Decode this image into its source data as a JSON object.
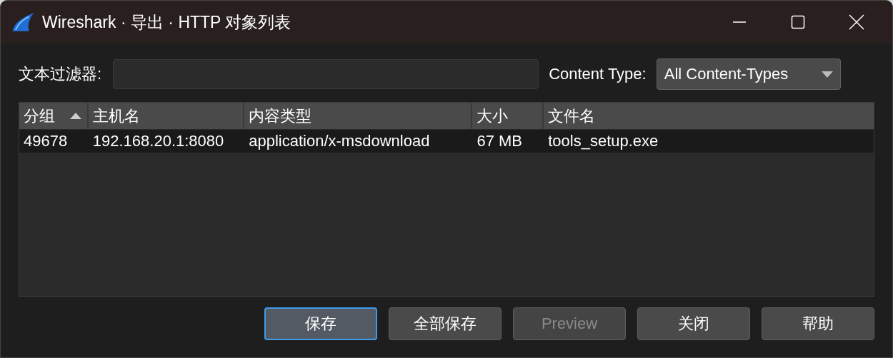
{
  "window": {
    "title": "Wireshark · 导出 · HTTP 对象列表"
  },
  "filter": {
    "label": "文本过滤器:"
  },
  "content_type": {
    "label": "Content Type:",
    "value": "All Content-Types"
  },
  "table": {
    "columns": [
      {
        "label": "分组",
        "sorted": true
      },
      {
        "label": "主机名",
        "sorted": false
      },
      {
        "label": "内容类型",
        "sorted": false
      },
      {
        "label": "大小",
        "sorted": false
      },
      {
        "label": "文件名",
        "sorted": false
      }
    ],
    "rows": [
      [
        "49678",
        "192.168.20.1:8080",
        "application/x-msdownload",
        "67 MB",
        "tools_setup.exe"
      ]
    ]
  },
  "buttons": [
    {
      "label": "保存",
      "default": true,
      "disabled": false
    },
    {
      "label": "全部保存",
      "default": false,
      "disabled": false
    },
    {
      "label": "Preview",
      "default": false,
      "disabled": true
    },
    {
      "label": "关闭",
      "default": false,
      "disabled": false
    },
    {
      "label": "帮助",
      "default": false,
      "disabled": false
    }
  ]
}
